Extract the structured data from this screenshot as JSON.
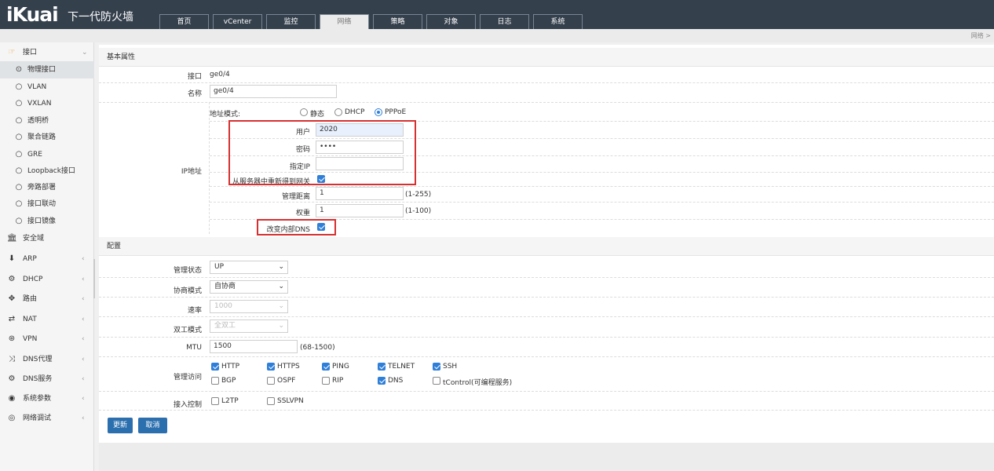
{
  "header": {
    "logo": "iKuai",
    "subtitle": "下一代防火墙"
  },
  "tabs": [
    {
      "label": "首页",
      "active": false
    },
    {
      "label": "vCenter",
      "active": false
    },
    {
      "label": "监控",
      "active": false
    },
    {
      "label": "网络",
      "active": true
    },
    {
      "label": "策略",
      "active": false
    },
    {
      "label": "对象",
      "active": false
    },
    {
      "label": "日志",
      "active": false
    },
    {
      "label": "系统",
      "active": false
    }
  ],
  "breadcrumb": "网络 >",
  "sidebar": {
    "interface": {
      "label": "接口",
      "icon": "hand-pointer-icon"
    },
    "sub_items": [
      {
        "label": "物理接口",
        "active": true
      },
      {
        "label": "VLAN"
      },
      {
        "label": "VXLAN"
      },
      {
        "label": "透明桥"
      },
      {
        "label": "聚合链路"
      },
      {
        "label": "GRE"
      },
      {
        "label": "Loopback接口"
      },
      {
        "label": "旁路部署"
      },
      {
        "label": "接口联动"
      },
      {
        "label": "接口镜像"
      }
    ],
    "groups": [
      {
        "label": "安全域",
        "icon": "bank-icon",
        "glyph": "🏛"
      },
      {
        "label": "ARP",
        "icon": "download-icon",
        "glyph": "⬇"
      },
      {
        "label": "DHCP",
        "icon": "network-icon",
        "glyph": "⚙"
      },
      {
        "label": "路由",
        "icon": "arrows-icon",
        "glyph": "✥"
      },
      {
        "label": "NAT",
        "icon": "swap-icon",
        "glyph": "⇄"
      },
      {
        "label": "VPN",
        "icon": "vpn-icon",
        "glyph": "⊛"
      },
      {
        "label": "DNS代理",
        "icon": "shuffle-icon",
        "glyph": "⤨"
      },
      {
        "label": "DNS服务",
        "icon": "cogs-icon",
        "glyph": "⚙"
      },
      {
        "label": "系统参数",
        "icon": "globe-icon",
        "glyph": "◉"
      },
      {
        "label": "网络调试",
        "icon": "target-icon",
        "glyph": "◎"
      }
    ]
  },
  "basic": {
    "section_title": "基本属性",
    "interface_label": "接口",
    "interface_value": "ge0/4",
    "name_label": "名称",
    "name_value": "ge0/4",
    "ip_label": "IP地址",
    "addr_mode_label": "地址模式:",
    "modes": {
      "static": "静态",
      "dhcp": "DHCP",
      "pppoe": "PPPoE",
      "selected": "PPPoE"
    },
    "user_label": "用户",
    "user_value": "2020",
    "password_label": "密码",
    "password_value": "••••",
    "specify_ip_label": "指定IP",
    "specify_ip_value": "",
    "gateway_label": "从服务器中重新得到网关",
    "gateway_checked": true,
    "distance_label": "管理距离",
    "distance_value": "1",
    "distance_range": "(1-255)",
    "weight_label": "权重",
    "weight_value": "1",
    "weight_range": "(1-100)",
    "dns_label": "改变内部DNS",
    "dns_checked": true
  },
  "config": {
    "section_title": "配置",
    "admin_state_label": "管理状态",
    "admin_state_value": "UP",
    "nego_label": "协商模式",
    "nego_value": "自协商",
    "speed_label": "速率",
    "speed_value": "1000",
    "duplex_label": "双工模式",
    "duplex_value": "全双工",
    "mtu_label": "MTU",
    "mtu_value": "1500",
    "mtu_range": "(68-1500)",
    "access_label": "管理访问",
    "access": [
      {
        "label": "HTTP",
        "checked": true
      },
      {
        "label": "HTTPS",
        "checked": true
      },
      {
        "label": "PING",
        "checked": true
      },
      {
        "label": "TELNET",
        "checked": true
      },
      {
        "label": "SSH",
        "checked": true
      },
      {
        "label": "BGP",
        "checked": false
      },
      {
        "label": "OSPF",
        "checked": false
      },
      {
        "label": "RIP",
        "checked": false
      },
      {
        "label": "DNS",
        "checked": true
      },
      {
        "label": "tControl(可编程服务)",
        "checked": false
      }
    ],
    "ingress_label": "接入控制",
    "ingress": [
      {
        "label": "L2TP",
        "checked": false
      },
      {
        "label": "SSLVPN",
        "checked": false
      }
    ]
  },
  "buttons": {
    "update": "更新",
    "cancel": "取消"
  },
  "colors": {
    "topbar": "#35404d",
    "accent": "#2f7fd9",
    "button": "#2b6fae",
    "highlight": "#d63031"
  }
}
